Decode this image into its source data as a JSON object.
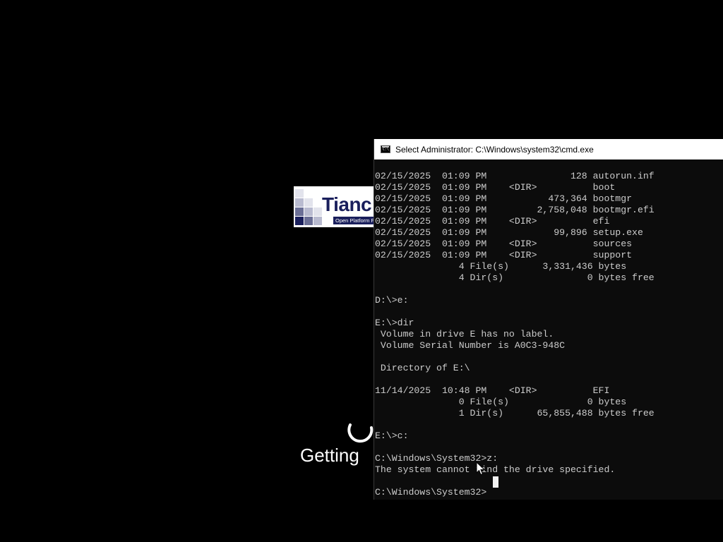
{
  "logo": {
    "word": "Tianc",
    "subtitle": "Open Platform F",
    "colors": {
      "navy": "#1a1f5c",
      "mid": "#6b6f96",
      "light": "#b9bbd0",
      "pale": "#e2e3ec"
    }
  },
  "boot": {
    "status_text": "Getting"
  },
  "cmd_window": {
    "title": "Select Administrator: C:\\Windows\\system32\\cmd.exe",
    "icon": "console-icon",
    "lines": [
      "02/15/2025  01:09 PM               128 autorun.inf",
      "02/15/2025  01:09 PM    <DIR>          boot",
      "02/15/2025  01:09 PM           473,364 bootmgr",
      "02/15/2025  01:09 PM         2,758,048 bootmgr.efi",
      "02/15/2025  01:09 PM    <DIR>          efi",
      "02/15/2025  01:09 PM            99,896 setup.exe",
      "02/15/2025  01:09 PM    <DIR>          sources",
      "02/15/2025  01:09 PM    <DIR>          support",
      "               4 File(s)      3,331,436 bytes",
      "               4 Dir(s)               0 bytes free",
      "",
      "D:\\>e:",
      "",
      "E:\\>dir",
      " Volume in drive E has no label.",
      " Volume Serial Number is A0C3-948C",
      "",
      " Directory of E:\\",
      "",
      "11/14/2025  10:48 PM    <DIR>          EFI",
      "               0 File(s)              0 bytes",
      "               1 Dir(s)      65,855,488 bytes free",
      "",
      "E:\\>c:",
      "",
      "C:\\Windows\\System32>z:",
      "The system cannot find the drive specified.",
      "",
      "C:\\Windows\\System32>"
    ]
  }
}
